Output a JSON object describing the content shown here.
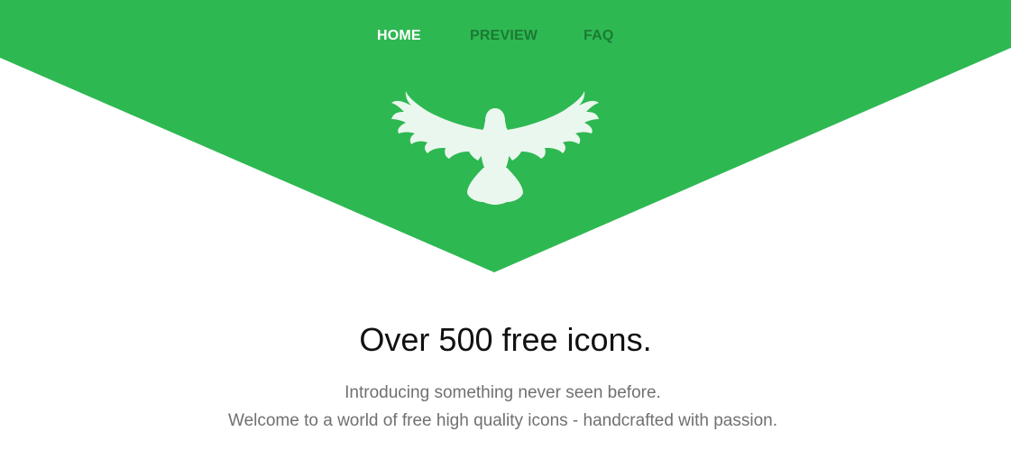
{
  "colors": {
    "brand_green": "#2eb852",
    "nav_active": "#ffffff",
    "nav_inactive": "#1c7a34",
    "bird": "#eaf7ee",
    "headline": "#111111",
    "subtext": "#707070"
  },
  "nav": {
    "items": [
      {
        "label": "HOME",
        "active": true
      },
      {
        "label": "PREVIEW",
        "active": false
      },
      {
        "label": "FAQ",
        "active": false
      }
    ]
  },
  "hero": {
    "logo_icon": "bird-icon"
  },
  "main": {
    "headline": "Over 500 free icons.",
    "subtitle_line1": "Introducing something never seen before.",
    "subtitle_line2": "Welcome to a world of free high quality icons - handcrafted with passion."
  }
}
